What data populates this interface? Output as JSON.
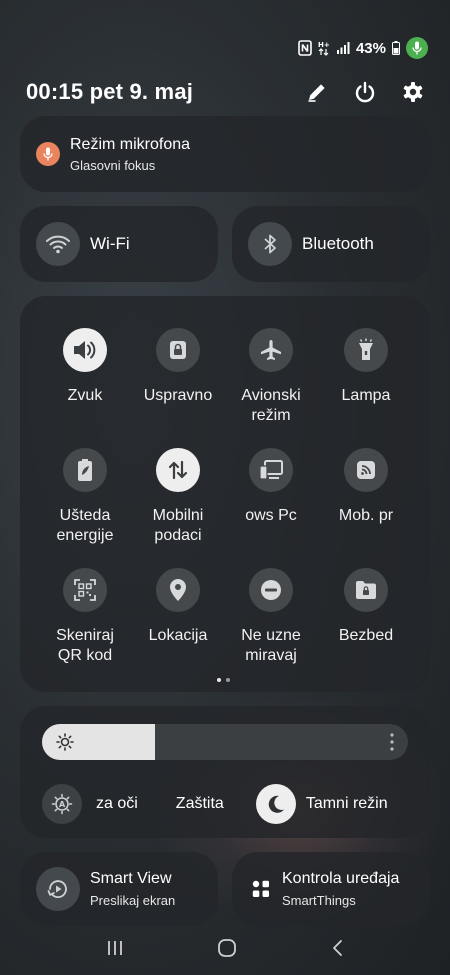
{
  "status": {
    "battery": "43%"
  },
  "header": {
    "datetime": "00:15 pet 9. maj"
  },
  "mic_mode": {
    "title": "Režim mikrofona",
    "subtitle": "Glasovni fokus"
  },
  "wifi": {
    "label": "Wi-Fi"
  },
  "bluetooth": {
    "label": "Bluetooth"
  },
  "tiles": [
    {
      "label": "Zvuk",
      "icon": "speaker-icon",
      "active": true
    },
    {
      "label": "Uspravno",
      "icon": "lock-rotation-icon",
      "active": false
    },
    {
      "label": "Avionski\nrežim",
      "icon": "airplane-icon",
      "active": false
    },
    {
      "label": "Lampa",
      "icon": "flashlight-icon",
      "active": false
    },
    {
      "label": "Ušteda\nenergije",
      "icon": "battery-saver-icon",
      "active": false
    },
    {
      "label": "Mobilni\npodaci",
      "icon": "mobile-data-icon",
      "active": true
    },
    {
      "label": "ows     Pc",
      "icon": "windows-link-icon",
      "active": false
    },
    {
      "label": "Mob. pr",
      "icon": "mobile-hotspot-icon",
      "active": false
    },
    {
      "label": "Skeniraj\nQR kod",
      "icon": "qr-scan-icon",
      "active": false
    },
    {
      "label": "Lokacija",
      "icon": "location-icon",
      "active": false
    },
    {
      "label": "Ne uzne\nmiravaj",
      "icon": "do-not-disturb-icon",
      "active": false
    },
    {
      "label": "Bezbed",
      "icon": "secure-folder-icon",
      "active": false
    }
  ],
  "pager": {
    "pages": 2,
    "current": 1
  },
  "brightness": {
    "level": 0.31,
    "eye_comfort": "za oči",
    "protection": "Zaštita",
    "dark_mode": "Tamni režin"
  },
  "smart_view": {
    "title": "Smart View",
    "subtitle": "Preslikaj ekran"
  },
  "device_control": {
    "title": "Kontrola uređaja",
    "subtitle": "SmartThings"
  },
  "colors": {
    "accent_orange": "#e9845e",
    "mic_green": "#4caf50",
    "tile_on": "#eeeeee",
    "tile_off": "#45494c"
  }
}
